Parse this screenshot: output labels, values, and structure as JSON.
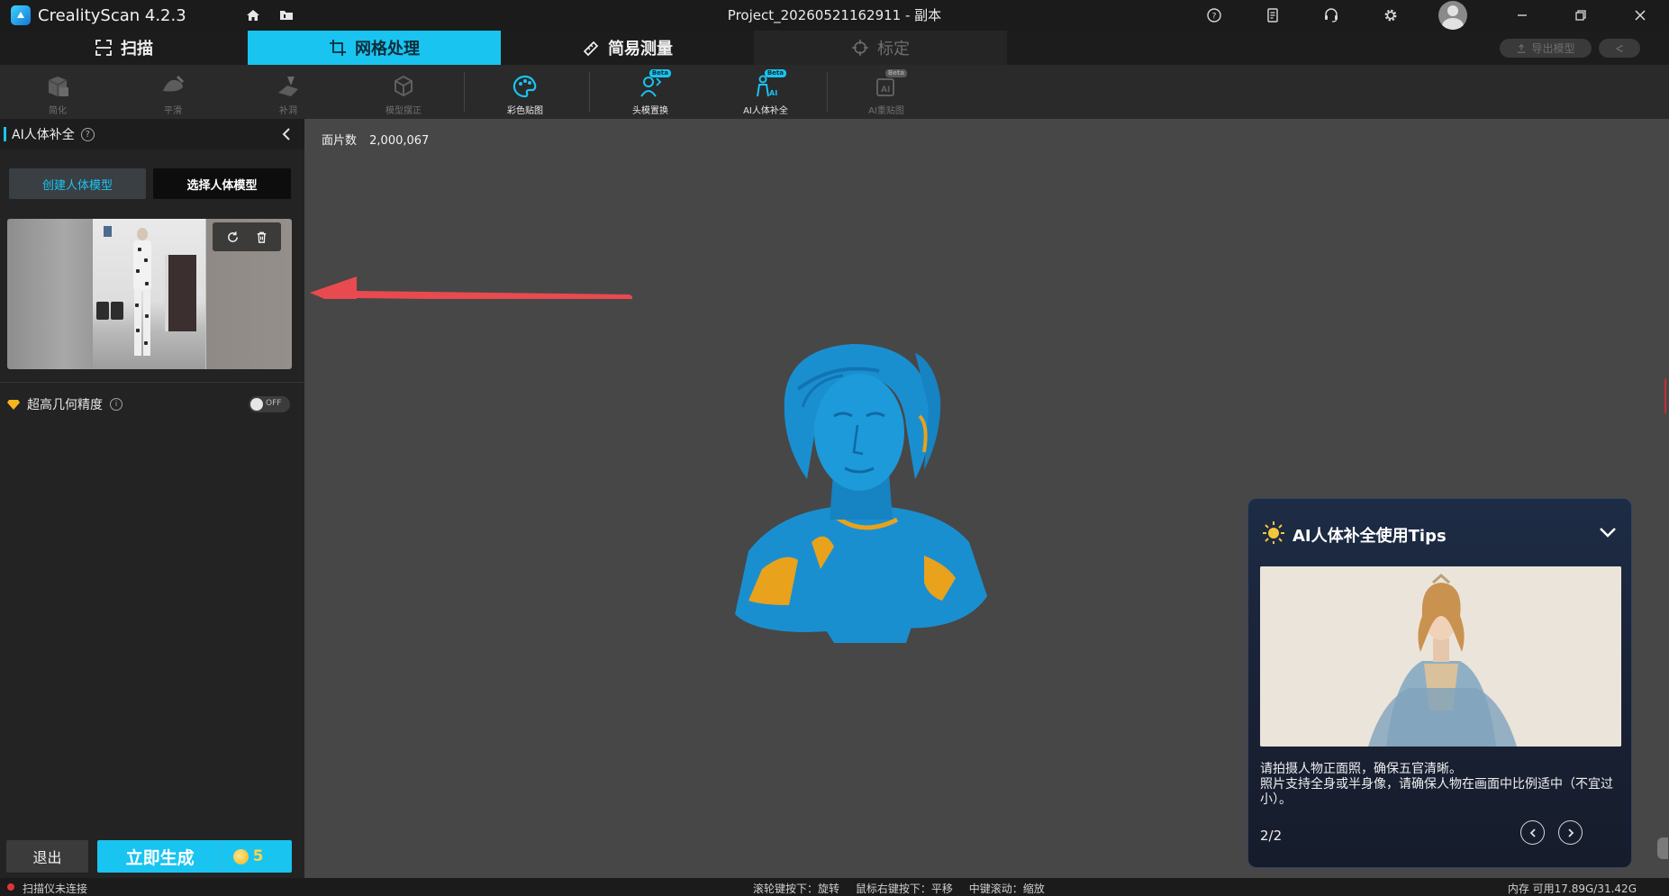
{
  "app": {
    "name": "CrealityScan 4.2.3",
    "project_title": "Project_20260521162911 - 副本"
  },
  "tabs": [
    {
      "label": "扫描",
      "icon": "scan-frame-icon"
    },
    {
      "label": "网格处理",
      "icon": "crop-mesh-icon"
    },
    {
      "label": "简易测量",
      "icon": "ruler-icon"
    },
    {
      "label": "标定",
      "icon": "crosshair-icon"
    }
  ],
  "top_right": {
    "export_label": "导出模型",
    "share_label": ""
  },
  "toolbar": {
    "tools": [
      {
        "label": "简化",
        "icon": "simplify-icon",
        "enabled": false
      },
      {
        "label": "平滑",
        "icon": "smooth-icon",
        "enabled": false
      },
      {
        "label": "补洞",
        "icon": "fill-hole-icon",
        "enabled": false
      },
      {
        "label": "模型摆正",
        "icon": "align-model-icon",
        "enabled": false
      },
      {
        "label": "彩色贴图",
        "icon": "palette-icon",
        "enabled": true
      },
      {
        "label": "头模置换",
        "icon": "head-swap-icon",
        "enabled": true,
        "badge": "Beta"
      },
      {
        "label": "AI人体补全",
        "icon": "ai-body-icon",
        "enabled": true,
        "badge": "Beta"
      },
      {
        "label": "AI重贴图",
        "icon": "ai-retexture-icon",
        "enabled": false,
        "badge": "Beta"
      }
    ]
  },
  "left_panel": {
    "title": "AI人体补全",
    "help": "?",
    "create_label": "创建人体模型",
    "select_label": "选择人体模型",
    "high_precision_label": "超高几何精度",
    "info": "i",
    "toggle_text": "OFF",
    "exit_label": "退出",
    "generate_label": "立即生成",
    "generate_cost": "5"
  },
  "viewport": {
    "face_count_label": "面片数",
    "face_count_value": "2,000,067"
  },
  "tips": {
    "title": "AI人体补全使用Tips",
    "line1": "请拍摄人物正面照，确保五官清晰。",
    "line2": "照片支持全身或半身像，请确保人物在画面中比例适中（不宜过小）。",
    "page": "2/2"
  },
  "status": {
    "scanner": "扫描仪未连接",
    "hint_rotate": "滚轮键按下：旋转",
    "hint_pan": "鼠标右键按下：平移",
    "hint_zoom": "中键滚动：缩放",
    "memory": "内存 可用17.89G/31.42G"
  },
  "colors": {
    "accent": "#19c4f0",
    "model": "#1a8fd0",
    "model_patch": "#e8a21c",
    "arrow": "#e84a4f"
  }
}
